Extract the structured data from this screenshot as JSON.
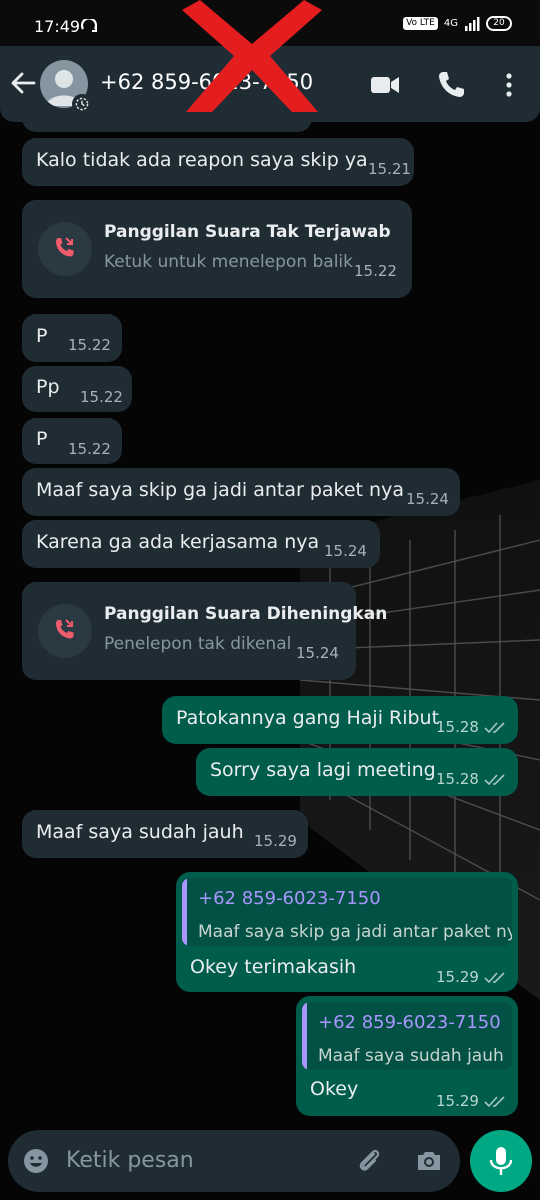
{
  "status_bar": {
    "time": "17:49",
    "network_chip": "Vo LTE",
    "network": "4G",
    "battery": "20"
  },
  "header": {
    "contact": "+62 859-6023-7150"
  },
  "messages": [
    {
      "dir": "in",
      "text": "Kalo tidak ada reapon saya skip ya",
      "time": "15.21"
    },
    {
      "dir": "in",
      "type": "call",
      "title": "Panggilan Suara Tak Terjawab",
      "subtitle": "Ketuk untuk menelepon balik",
      "time": "15.22"
    },
    {
      "dir": "in",
      "text": "P",
      "time": "15.22"
    },
    {
      "dir": "in",
      "text": "Pp",
      "time": "15.22"
    },
    {
      "dir": "in",
      "text": "P",
      "time": "15.22"
    },
    {
      "dir": "in",
      "text": "Maaf saya skip ga jadi antar paket nya",
      "time": "15.24"
    },
    {
      "dir": "in",
      "text": "Karena ga ada kerjasama nya",
      "time": "15.24"
    },
    {
      "dir": "in",
      "type": "call",
      "title": "Panggilan Suara Diheningkan",
      "subtitle": "Penelepon tak dikenal",
      "time": "15.24"
    },
    {
      "dir": "out",
      "text": "Patokannya gang Haji Ribut",
      "time": "15.28"
    },
    {
      "dir": "out",
      "text": "Sorry saya lagi meeting",
      "time": "15.28"
    },
    {
      "dir": "in",
      "text": "Maaf saya sudah jauh",
      "time": "15.29"
    },
    {
      "dir": "out",
      "quote_name": "+62 859-6023-7150",
      "quote_text": "Maaf saya skip ga jadi antar paket nya",
      "text": "Okey terimakasih",
      "time": "15.29"
    },
    {
      "dir": "out",
      "quote_name": "+62 859-6023-7150",
      "quote_text": "Maaf saya sudah jauh",
      "text": "Okey",
      "time": "15.29"
    }
  ],
  "input": {
    "placeholder": "Ketik pesan"
  },
  "colors": {
    "incoming": "#202c33",
    "outgoing": "#005c4b",
    "accent": "#00a884",
    "quote_name": "#a996ff",
    "missed_call": "#f15c6d"
  }
}
